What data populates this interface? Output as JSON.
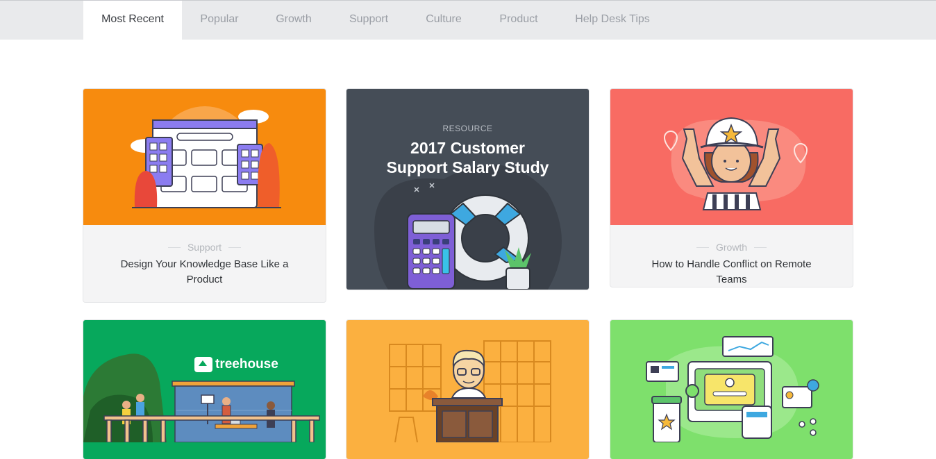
{
  "tabs": [
    {
      "label": "Most Recent",
      "active": true
    },
    {
      "label": "Popular",
      "active": false
    },
    {
      "label": "Growth",
      "active": false
    },
    {
      "label": "Support",
      "active": false
    },
    {
      "label": "Culture",
      "active": false
    },
    {
      "label": "Product",
      "active": false
    },
    {
      "label": "Help Desk Tips",
      "active": false
    }
  ],
  "cards": [
    {
      "category": "Support",
      "title": "Design Your Knowledge Base Like a Product",
      "image_bg": "#f78b0e",
      "illustration": "browser-window-illustration"
    },
    {
      "label": "RESOURCE",
      "title": "2017 Customer Support Salary Study",
      "image_bg": "#454d57",
      "illustration": "calculator-lifebuoy-illustration"
    },
    {
      "category": "Growth",
      "title": "How to Handle Conflict on Remote Teams",
      "image_bg": "#f86b63",
      "illustration": "referee-illustration"
    },
    {
      "brand": "treehouse",
      "image_bg": "#07a85c",
      "illustration": "treehouse-office-illustration"
    },
    {
      "image_bg": "#fbb040",
      "illustration": "library-desk-illustration"
    },
    {
      "image_bg": "#7ee06c",
      "illustration": "dashboard-devices-illustration"
    }
  ]
}
